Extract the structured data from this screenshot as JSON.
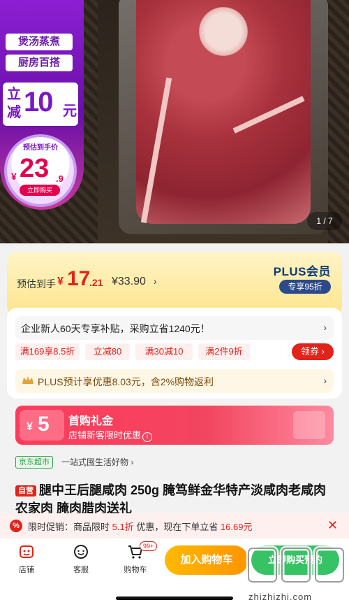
{
  "hero": {
    "tag1": "煲汤蒸煮",
    "tag2": "厨房百搭",
    "reduce_prefix": "立减",
    "reduce_amount": "10",
    "reduce_unit": "元",
    "est_label": "预估到手价",
    "est_yen": "¥",
    "est_int": "23",
    "est_dec": ".9",
    "buy_now": "立即购买",
    "pager": "1 / 7"
  },
  "price_panel": {
    "label": "预估到手",
    "yen": "¥",
    "price_int": "17",
    "price_dec": ".21",
    "orig": "¥33.90",
    "orig_arrow": "›",
    "plus_title": "PLUS会员",
    "plus_badge": "专享95折"
  },
  "card": {
    "newuser_text": "企业新人60天专享补贴，采购立省1240元！",
    "newuser_chev": "›",
    "chips": [
      "满169享8.5折",
      "立减80",
      "满30减10",
      "满2件9折"
    ],
    "coupon_btn": "领券 ›",
    "plus_text": "PLUS预计享优惠8.03元，含2%购物返利",
    "plus_chev": "›"
  },
  "gift": {
    "yen": "¥",
    "amount": "5",
    "title": "首购礼金",
    "sub": "店铺新客限时优惠",
    "info": "i"
  },
  "store": {
    "tag": "京东超市",
    "desc": "一站式囤生活好物 ›"
  },
  "product": {
    "self_op": "自营",
    "title": "腿中王后腿咸肉 250g 腌笃鲜金华特产淡咸肉老咸肉 农家肉 腌肉腊肉送礼"
  },
  "promo": {
    "icon": "%",
    "text_a": "限时促销：商品限时 ",
    "discount": "5.1折",
    "text_b": " 优惠，现在下单立省 ",
    "save": "16.69元",
    "close": "✕"
  },
  "bottombar": {
    "store": "店铺",
    "service": "客服",
    "cart": "购物车",
    "cart_badge": "99+",
    "add_cart": "加入购物车",
    "presale": "立即购买预约"
  },
  "watermark": "zhizhizhi.com",
  "colors": {
    "jd_red": "#e2231a",
    "purple": "#7a18c5",
    "plus_navy": "#2c4a8a",
    "orange": "#ff9400",
    "green": "#38c266"
  }
}
